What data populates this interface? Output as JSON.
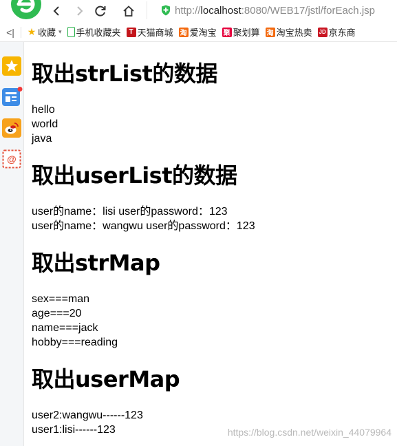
{
  "browser": {
    "url_prefix": "http://",
    "url_host": "localhost",
    "url_path": ":8080/WEB17/jstl/forEach.jsp"
  },
  "bookmarks": [
    {
      "label": "收藏",
      "icon": "star-icon",
      "color": "#f5b400"
    },
    {
      "label": "手机收藏夹",
      "icon": "phone-icon",
      "color": "#2ab24c"
    },
    {
      "label": "天猫商城",
      "icon": "tmall-icon",
      "color": "#c4161c"
    },
    {
      "label": "爱淘宝",
      "icon": "taobao-icon",
      "color": "#f36a10"
    },
    {
      "label": "聚划算",
      "icon": "juhuasuan-icon",
      "color": "#e6003d"
    },
    {
      "label": "淘宝热卖",
      "icon": "taobao-icon",
      "color": "#f36a10"
    },
    {
      "label": "京东商",
      "icon": "jd-icon",
      "color": "#c91623"
    }
  ],
  "sidebar": [
    {
      "icon": "favorites-star-icon"
    },
    {
      "icon": "news-icon"
    },
    {
      "icon": "weibo-icon"
    },
    {
      "icon": "email-icon"
    }
  ],
  "sections": [
    {
      "title": "取出strList的数据",
      "lines": [
        "hello",
        "world",
        "java"
      ]
    },
    {
      "title": "取出userList的数据",
      "lines": [
        "user的name：lisi user的password：123",
        "user的name：wangwu user的password：123"
      ]
    },
    {
      "title": "取出strMap",
      "lines": [
        "sex===man",
        "age===20",
        "name===jack",
        "hobby===reading"
      ]
    },
    {
      "title": "取出userMap",
      "lines": [
        "user2:wangwu------123",
        "user1:lisi------123"
      ]
    }
  ],
  "watermark": "https://blog.csdn.net/weixin_44079964"
}
